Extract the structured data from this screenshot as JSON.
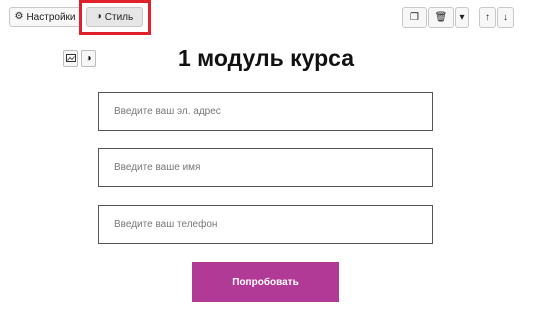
{
  "toolbar": {
    "settings_label": "Настройки",
    "style_label": "Стиль",
    "settings_icon": "gear-icon",
    "style_icon": "contrast-icon",
    "copy_icon": "copy-icon",
    "delete_icon": "trash-icon",
    "dropdown_icon": "caret-down-icon",
    "move_up_icon": "arrow-up-icon",
    "move_down_icon": "arrow-down-icon"
  },
  "form": {
    "title": "1 модуль курса",
    "email_placeholder": "Введите ваш эл. адрес",
    "name_placeholder": "Введите ваше имя",
    "phone_placeholder": "Введите ваш телефон",
    "submit_label": "Попробовать"
  },
  "colors": {
    "accent": "#b23a97",
    "highlight": "#e0202a"
  }
}
